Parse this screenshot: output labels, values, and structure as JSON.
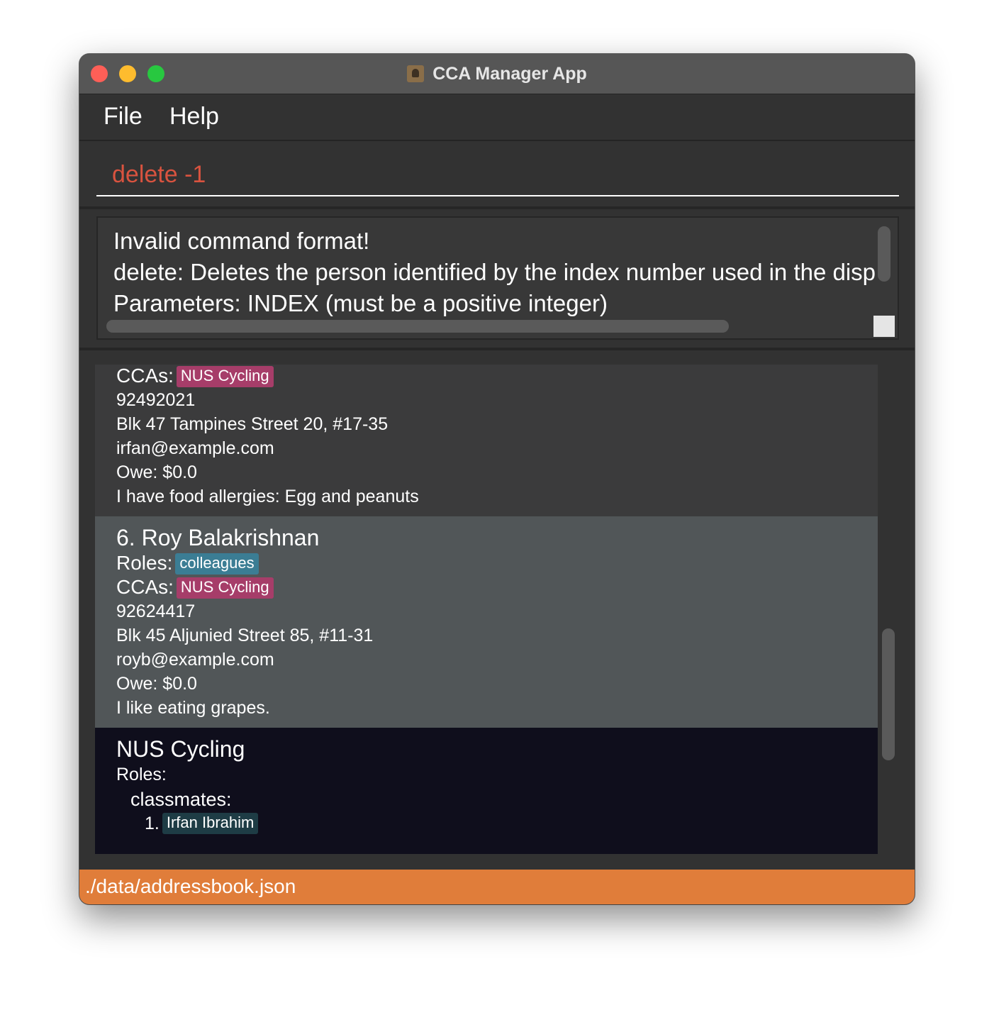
{
  "window": {
    "title": "CCA Manager App"
  },
  "menu": {
    "file": "File",
    "help": "Help"
  },
  "command": {
    "value": "delete -1"
  },
  "result": {
    "lines": [
      "Invalid command format!",
      "delete: Deletes the person identified by the index number used in the displa",
      "Parameters: INDEX (must be a positive integer)"
    ]
  },
  "persons": {
    "partial": {
      "ccas_label": "CCAs:",
      "cca": "NUS Cycling",
      "phone": "92492021",
      "address": "Blk 47 Tampines Street 20, #17-35",
      "email": "irfan@example.com",
      "owe": "Owe: $0.0",
      "remark": "I have food allergies: Egg and peanuts"
    },
    "selected": {
      "index_name": "6.  Roy Balakrishnan",
      "roles_label": "Roles:",
      "role": "colleagues",
      "ccas_label": "CCAs:",
      "cca": "NUS Cycling",
      "phone": "92624417",
      "address": "Blk 45 Aljunied Street 85, #11-31",
      "email": "royb@example.com",
      "owe": "Owe: $0.0",
      "remark": "I like eating grapes."
    }
  },
  "cca_card": {
    "name": "NUS Cycling",
    "roles_label": "Roles:",
    "role_group": "classmates:",
    "member_index": "1.",
    "member": "Irfan Ibrahim"
  },
  "status": {
    "path": "./data/addressbook.json"
  },
  "colors": {
    "command_text": "#d9533f",
    "cca_tag": "#a63d69",
    "role_tag": "#3b7d94",
    "member_tag": "#1e3c45",
    "status_bar": "#e07d3a",
    "selected_card": "#515658",
    "cca_card": "#0f0e1c"
  }
}
